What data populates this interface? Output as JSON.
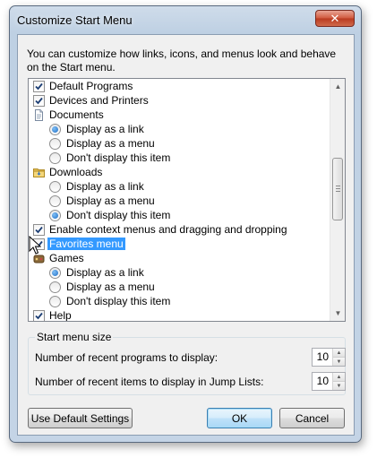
{
  "window": {
    "title": "Customize Start Menu",
    "close_glyph": "✕"
  },
  "intro": "You can customize how links, icons, and menus look and behave on the Start menu.",
  "list": {
    "items": [
      {
        "kind": "checkbox",
        "level": 0,
        "label": "Default Programs",
        "checked": true
      },
      {
        "kind": "checkbox",
        "level": 0,
        "label": "Devices and Printers",
        "checked": true
      },
      {
        "kind": "header",
        "level": 0,
        "label": "Documents",
        "icon": "document-icon"
      },
      {
        "kind": "radio",
        "level": 1,
        "label": "Display as a link",
        "checked": true
      },
      {
        "kind": "radio",
        "level": 1,
        "label": "Display as a menu",
        "checked": false
      },
      {
        "kind": "radio",
        "level": 1,
        "label": "Don't display this item",
        "checked": false
      },
      {
        "kind": "header",
        "level": 0,
        "label": "Downloads",
        "icon": "folder-icon"
      },
      {
        "kind": "radio",
        "level": 1,
        "label": "Display as a link",
        "checked": false
      },
      {
        "kind": "radio",
        "level": 1,
        "label": "Display as a menu",
        "checked": false
      },
      {
        "kind": "radio",
        "level": 1,
        "label": "Don't display this item",
        "checked": true
      },
      {
        "kind": "checkbox",
        "level": 0,
        "label": "Enable context menus and dragging and dropping",
        "checked": true
      },
      {
        "kind": "checkbox",
        "level": 0,
        "label": "Favorites menu",
        "checked": true,
        "selected": true
      },
      {
        "kind": "header",
        "level": 0,
        "label": "Games",
        "icon": "games-icon"
      },
      {
        "kind": "radio",
        "level": 1,
        "label": "Display as a link",
        "checked": true
      },
      {
        "kind": "radio",
        "level": 1,
        "label": "Display as a menu",
        "checked": false
      },
      {
        "kind": "radio",
        "level": 1,
        "label": "Don't display this item",
        "checked": false
      },
      {
        "kind": "checkbox",
        "level": 0,
        "label": "Help",
        "checked": true
      }
    ]
  },
  "recent": {
    "group_label": "Start menu size",
    "programs_label": "Number of recent programs to display:",
    "programs_value": "10",
    "jumplist_label": "Number of recent items to display in Jump Lists:",
    "jumplist_value": "10"
  },
  "buttons": {
    "defaults": "Use Default Settings",
    "ok": "OK",
    "cancel": "Cancel"
  },
  "colors": {
    "selection": "#3399ff",
    "accent": "#3c7fb1"
  }
}
